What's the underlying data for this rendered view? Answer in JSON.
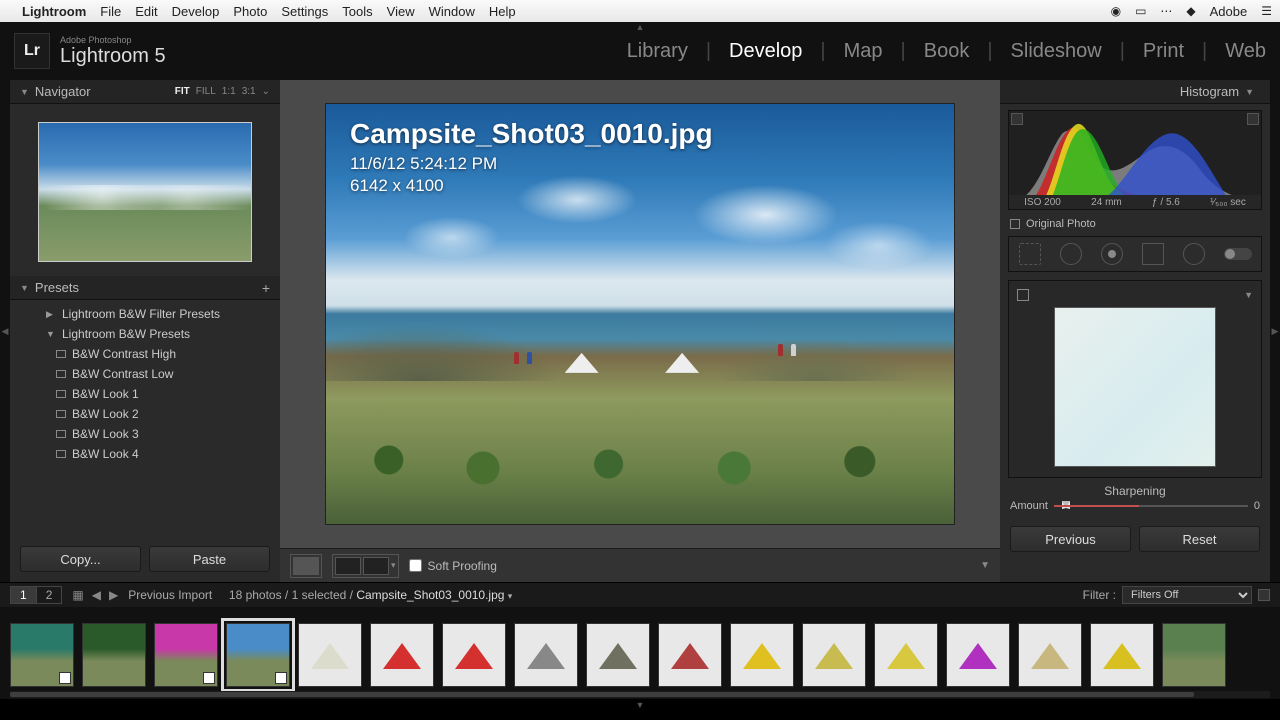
{
  "menubar": {
    "app": "Lightroom",
    "items": [
      "File",
      "Edit",
      "Develop",
      "Photo",
      "Settings",
      "Tools",
      "View",
      "Window",
      "Help"
    ],
    "right_brand": "Adobe"
  },
  "identity": {
    "small": "Adobe Photoshop",
    "product": "Lightroom 5",
    "mark": "Lr"
  },
  "modules": [
    "Library",
    "Develop",
    "Map",
    "Book",
    "Slideshow",
    "Print",
    "Web"
  ],
  "modules_active": "Develop",
  "navigator": {
    "title": "Navigator",
    "zoom": [
      "FIT",
      "FILL",
      "1:1",
      "3:1"
    ],
    "zoom_sel": "FIT"
  },
  "presets": {
    "title": "Presets",
    "groups": [
      {
        "name": "Lightroom B&W Filter Presets",
        "open": false
      },
      {
        "name": "Lightroom B&W Presets",
        "open": true,
        "items": [
          "B&W Contrast High",
          "B&W Contrast Low",
          "B&W Look 1",
          "B&W Look 2",
          "B&W Look 3",
          "B&W Look 4"
        ]
      }
    ]
  },
  "left_buttons": {
    "copy": "Copy...",
    "paste": "Paste"
  },
  "image_meta": {
    "filename": "Campsite_Shot03_0010.jpg",
    "datetime": "11/6/12 5:24:12 PM",
    "dimensions": "6142 x 4100"
  },
  "center_toolbar": {
    "soft_proof": "Soft Proofing"
  },
  "histogram": {
    "title": "Histogram",
    "iso": "ISO 200",
    "focal": "24 mm",
    "aperture": "ƒ / 5.6",
    "shutter": "¹⁄₅₀₀ sec",
    "original": "Original Photo"
  },
  "detail": {
    "sharpening": "Sharpening",
    "amount_label": "Amount",
    "amount_value": "0"
  },
  "right_buttons": {
    "prev": "Previous",
    "reset": "Reset"
  },
  "filmstrip_bar": {
    "monitor_primary": "1",
    "monitor_secondary": "2",
    "collection": "Previous Import",
    "count": "18 photos / 1 selected /",
    "current": "Campsite_Shot03_0010.jpg",
    "filter_label": "Filter :",
    "filter_value": "Filters Off"
  },
  "thumbnails": [
    {
      "kind": "photo",
      "color": "#2a7a6a",
      "flag": true
    },
    {
      "kind": "photo",
      "color": "#2a5a2a"
    },
    {
      "kind": "photo",
      "color": "#c838a8",
      "flag": true
    },
    {
      "kind": "photo",
      "color": "#4a8cc8",
      "sel": true,
      "flag": true
    },
    {
      "kind": "product",
      "color": "#dcdccc"
    },
    {
      "kind": "product",
      "color": "#d43030"
    },
    {
      "kind": "product",
      "color": "#d43030"
    },
    {
      "kind": "product",
      "color": "#888"
    },
    {
      "kind": "product",
      "color": "#707060"
    },
    {
      "kind": "product",
      "color": "#b04040"
    },
    {
      "kind": "product",
      "color": "#e0c020"
    },
    {
      "kind": "product",
      "color": "#c8bc50"
    },
    {
      "kind": "product",
      "color": "#d8c840"
    },
    {
      "kind": "product",
      "color": "#b030c0"
    },
    {
      "kind": "product",
      "color": "#c8b880"
    },
    {
      "kind": "product",
      "color": "#d8c020"
    },
    {
      "kind": "photo",
      "color": "#5a8050"
    }
  ]
}
